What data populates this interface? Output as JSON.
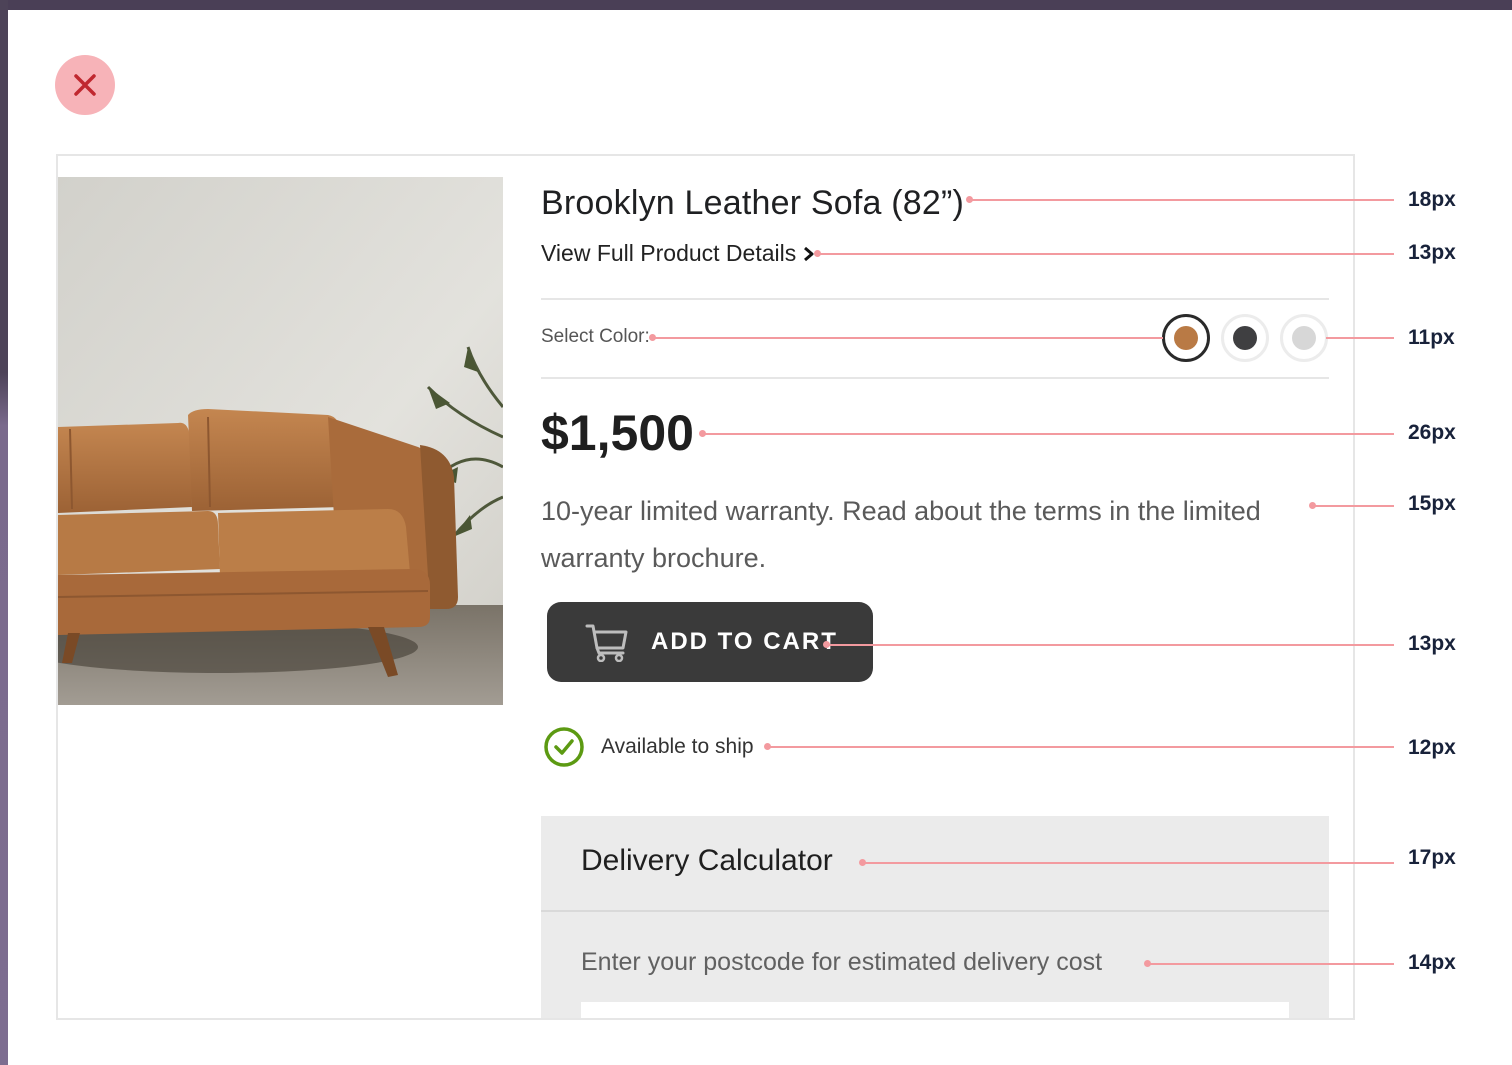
{
  "product": {
    "title": "Brooklyn Leather Sofa (82”)",
    "details_link": "View Full Product Details",
    "color_label": "Select Color:",
    "colors": [
      "#b97a45",
      "#3f3f41",
      "#d7d7d7"
    ],
    "selected_color_index": 0,
    "price": "$1,500",
    "warranty": "10-year limited warranty. Read about the terms in the limited warranty brochure.",
    "add_to_cart": "ADD TO CART",
    "availability": "Available to ship"
  },
  "delivery": {
    "title": "Delivery Calculator",
    "subtitle": "Enter your postcode for estimated delivery cost",
    "postcode_value": ""
  },
  "annotations": [
    "18px",
    "13px",
    "11px",
    "26px",
    "15px",
    "13px",
    "12px",
    "17px",
    "14px"
  ],
  "colors": {
    "close_button_bg": "#f7b3b8",
    "close_icon": "#c0282f",
    "cart_button_bg": "#3a3a3a",
    "ship_check": "#5c9a12",
    "guide_line": "#f39a9f"
  },
  "icons": [
    "close-icon",
    "chevron-right-icon",
    "cart-icon",
    "check-circle-icon"
  ]
}
